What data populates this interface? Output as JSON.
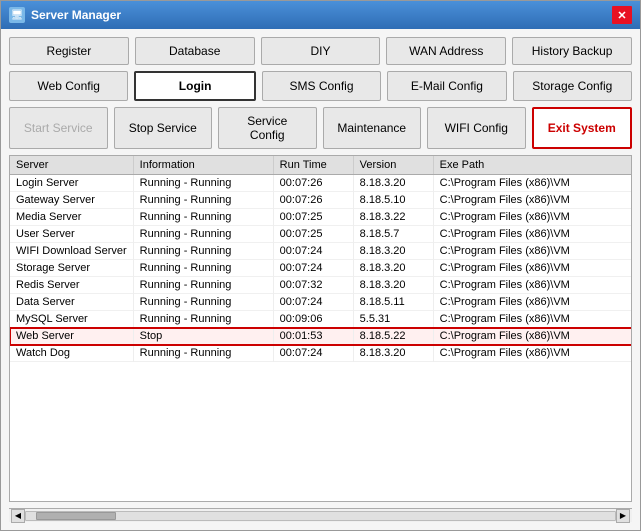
{
  "window": {
    "title": "Server Manager",
    "close_label": "✕"
  },
  "toolbar_row1": {
    "register": "Register",
    "database": "Database",
    "diy": "DIY",
    "wan_address": "WAN Address",
    "history_backup": "History Backup"
  },
  "toolbar_row2": {
    "web_config": "Web Config",
    "login": "Login",
    "sms_config": "SMS Config",
    "email_config": "E-Mail Config",
    "storage_config": "Storage Config"
  },
  "toolbar_row3": {
    "start_service": "Start Service",
    "stop_service": "Stop Service",
    "service_config": "Service Config",
    "maintenance": "Maintenance",
    "wifi_config": "WIFI Config",
    "exit_system": "Exit System"
  },
  "table": {
    "headers": [
      "Server",
      "Information",
      "Run Time",
      "Version",
      "Exe Path"
    ],
    "rows": [
      {
        "server": "Login Server",
        "info": "Running - Running",
        "runtime": "00:07:26",
        "version": "8.18.3.20",
        "path": "C:\\Program Files (x86)\\VM",
        "highlight": false
      },
      {
        "server": "Gateway Server",
        "info": "Running - Running",
        "runtime": "00:07:26",
        "version": "8.18.5.10",
        "path": "C:\\Program Files (x86)\\VM",
        "highlight": false
      },
      {
        "server": "Media Server",
        "info": "Running - Running",
        "runtime": "00:07:25",
        "version": "8.18.3.22",
        "path": "C:\\Program Files (x86)\\VM",
        "highlight": false
      },
      {
        "server": "User Server",
        "info": "Running - Running",
        "runtime": "00:07:25",
        "version": "8.18.5.7",
        "path": "C:\\Program Files (x86)\\VM",
        "highlight": false
      },
      {
        "server": "WIFI Download Server",
        "info": "Running - Running",
        "runtime": "00:07:24",
        "version": "8.18.3.20",
        "path": "C:\\Program Files (x86)\\VM",
        "highlight": false
      },
      {
        "server": "Storage Server",
        "info": "Running - Running",
        "runtime": "00:07:24",
        "version": "8.18.3.20",
        "path": "C:\\Program Files (x86)\\VM",
        "highlight": false
      },
      {
        "server": "Redis Server",
        "info": "Running - Running",
        "runtime": "00:07:32",
        "version": "8.18.3.20",
        "path": "C:\\Program Files (x86)\\VM",
        "highlight": false
      },
      {
        "server": "Data Server",
        "info": "Running - Running",
        "runtime": "00:07:24",
        "version": "8.18.5.11",
        "path": "C:\\Program Files (x86)\\VM",
        "highlight": false
      },
      {
        "server": "MySQL Server",
        "info": "Running - Running",
        "runtime": "00:09:06",
        "version": "5.5.31",
        "path": "C:\\Program Files (x86)\\VM",
        "highlight": false
      },
      {
        "server": "Web Server",
        "info": "Stop",
        "runtime": "00:01:53",
        "version": "8.18.5.22",
        "path": "C:\\Program Files (x86)\\VM",
        "highlight": true
      },
      {
        "server": "Watch Dog",
        "info": "Running - Running",
        "runtime": "00:07:24",
        "version": "8.18.3.20",
        "path": "C:\\Program Files (x86)\\VM",
        "highlight": false
      }
    ]
  }
}
